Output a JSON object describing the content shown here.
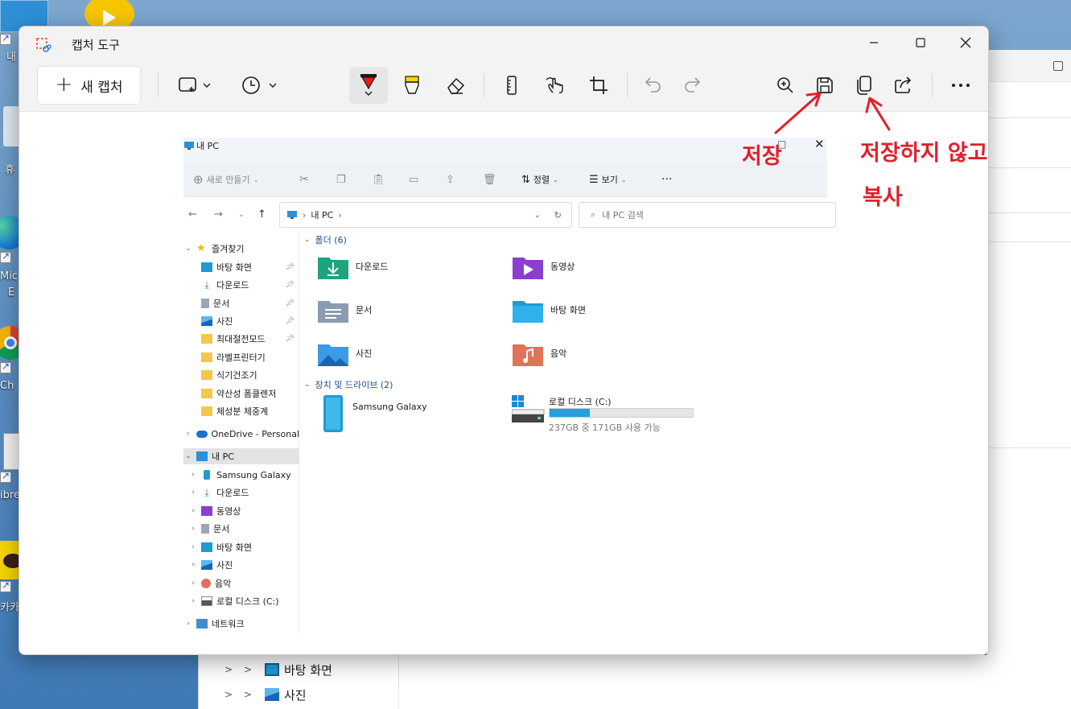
{
  "desktop": {
    "labels": [
      "내",
      "휴",
      "Mic",
      "E",
      "Ch",
      "ibre",
      "카카"
    ]
  },
  "app": {
    "title": "캡처 도구",
    "new_capture_label": "새 캡처",
    "window_controls": [
      "minimize-icon",
      "maximize-icon",
      "close-icon"
    ]
  },
  "toolbar": {
    "left": [
      "rectangle-snip-icon",
      "timer-icon"
    ],
    "middle": [
      "ballpoint-pen-icon",
      "highlighter-icon",
      "eraser-icon",
      "ruler-icon",
      "touch-writing-icon",
      "crop-icon"
    ],
    "history": [
      "undo-icon",
      "redo-icon"
    ],
    "right": [
      "zoom-icon",
      "save-icon",
      "copy-icon",
      "share-icon",
      "more-icon"
    ]
  },
  "captured_explorer": {
    "title": "내 PC",
    "commands": {
      "new": "새로 만들기",
      "sort": "정렬",
      "view": "보기"
    },
    "address": {
      "segment": "내 PC",
      "search_placeholder": "내 PC 검색"
    },
    "tree": {
      "favorites": "즐겨찾기",
      "favorites_items": [
        "바탕 화면",
        "다운로드",
        "문서",
        "사진",
        "최대절전모드",
        "라벨프린터기",
        "식기건조기",
        "약산성 폼클렌저",
        "체성분 체중계"
      ],
      "onedrive": "OneDrive - Personal",
      "this_pc": "내 PC",
      "pc_items": [
        "Samsung Galaxy",
        "다운로드",
        "동영상",
        "문서",
        "바탕 화면",
        "사진",
        "음악",
        "로컬 디스크 (C:)"
      ],
      "network": "네트워크"
    },
    "folders_header": "폴더 (6)",
    "folders": [
      "다운로드",
      "동영상",
      "문서",
      "바탕 화면",
      "사진",
      "음악"
    ],
    "devices_header": "장치 및 드라이브 (2)",
    "devices": {
      "phone": "Samsung Galaxy",
      "disk_name": "로컬 디스크 (C:)",
      "disk_info": "237GB 중 171GB 사용 가능",
      "disk_used_fraction": 0.28
    }
  },
  "annotations": {
    "save": "저장",
    "copy_line1": "저장하지 않고",
    "copy_line2": "복사",
    "color": "#e0202a"
  },
  "background_window": {
    "rows": [
      "바탕 화면",
      "사진"
    ]
  }
}
